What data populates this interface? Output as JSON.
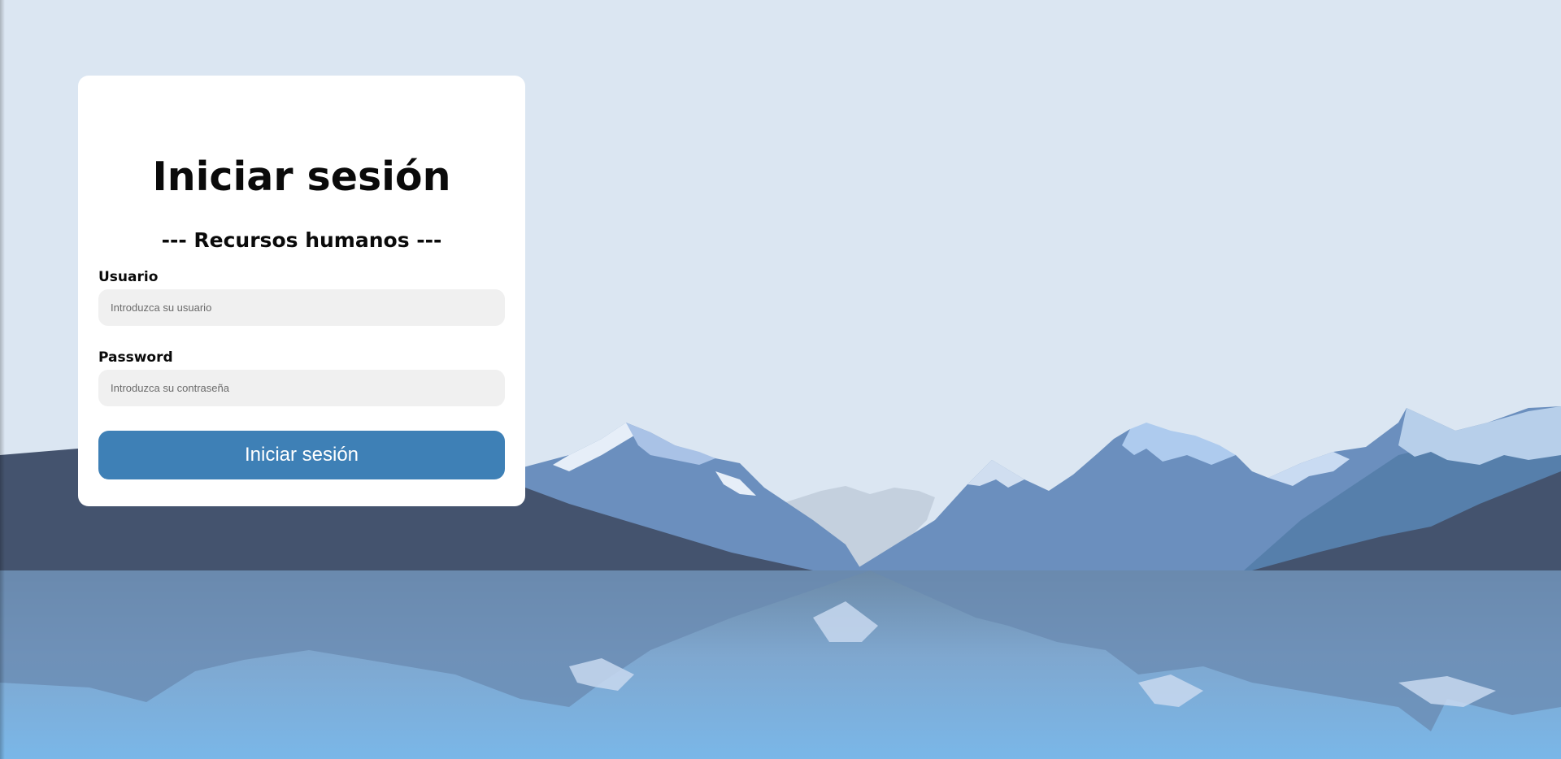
{
  "login": {
    "title": "Iniciar sesión",
    "subtitle": "--- Recursos humanos ---",
    "username_label": "Usuario",
    "username_placeholder": "Introduzca su usuario",
    "username_value": "",
    "password_label": "Password",
    "password_placeholder": "Introduzca su contraseña",
    "password_value": "",
    "submit_label": "Iniciar sesión"
  },
  "colors": {
    "sky": "#dbe6f2",
    "card": "#ffffff",
    "input_bg": "#f0f0f0",
    "button": "#3e80b6",
    "button_text": "#ffffff",
    "mountain_dark": "#44536e",
    "mountain_mid": "#6b8fbe",
    "lake_top": "#6b8aa8",
    "lake_bottom": "#7bb6e6"
  }
}
